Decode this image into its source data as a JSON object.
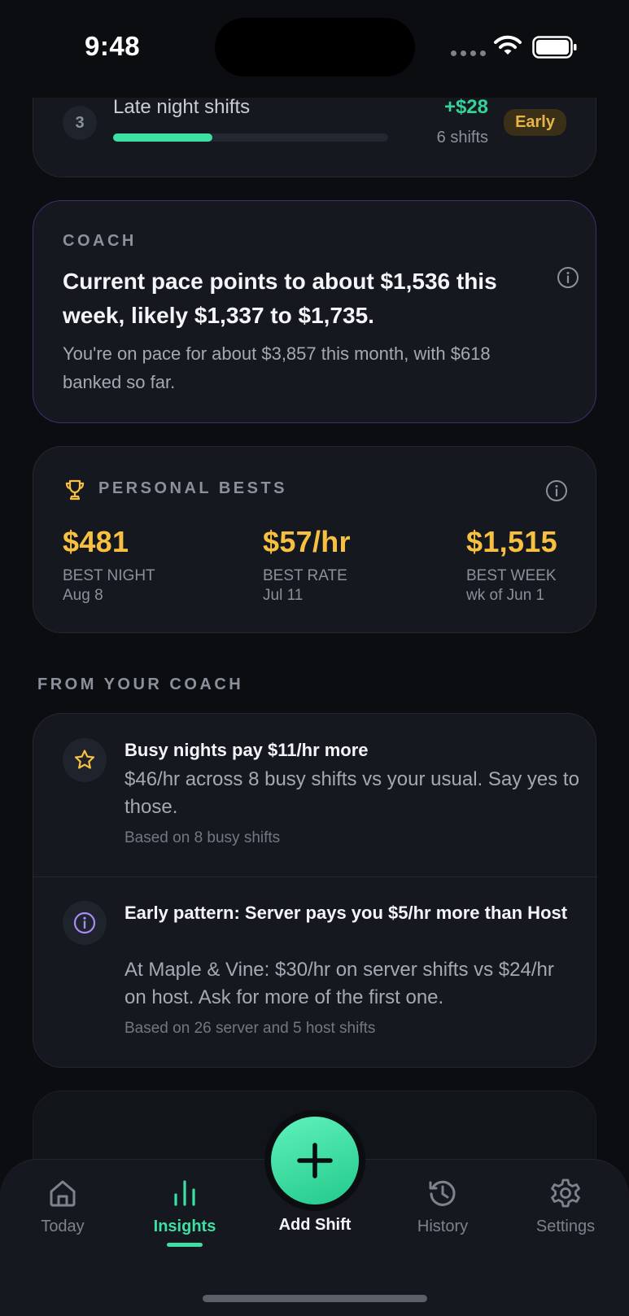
{
  "status_bar": {
    "time": "9:48"
  },
  "rank_item": {
    "rank": "3",
    "label": "Late night shifts",
    "progress_fraction": 0.36,
    "delta": "+$28",
    "count": "6 shifts",
    "badge": "Early"
  },
  "coach": {
    "eyebrow": "COACH",
    "headline": "Current pace points to about $1,536 this week, likely $1,337 to $1,735.",
    "sub": "You're on pace for about $3,857 this month, with $618 banked so far."
  },
  "personal_bests": {
    "eyebrow": "PERSONAL BESTS",
    "items": [
      {
        "value": "$481",
        "label": "BEST NIGHT",
        "date": "Aug 8"
      },
      {
        "value": "$57/hr",
        "label": "BEST RATE",
        "date": "Jul 11"
      },
      {
        "value": "$1,515",
        "label": "BEST WEEK",
        "date": "wk of Jun 1"
      }
    ]
  },
  "from_coach": {
    "title": "FROM YOUR COACH",
    "items": [
      {
        "icon": "star-icon",
        "title": "Busy nights pay $11/hr more",
        "body": "$46/hr across 8 busy shifts vs your usual. Say yes to those.",
        "meta": "Based on 8 busy shifts"
      },
      {
        "icon": "info-icon",
        "title": "Early pattern: Server pays you $5/hr more than Host",
        "body": "At Maple & Vine: $30/hr on server shifts vs $24/hr on host. Ask for more of the first one.",
        "meta": "Based on 26 server and 5 host shifts"
      }
    ]
  },
  "tabs": [
    {
      "label": "Today",
      "icon": "home-icon",
      "active": false
    },
    {
      "label": "Insights",
      "icon": "bar-chart-icon",
      "active": true
    },
    {
      "label": "Add Shift",
      "icon": "plus-icon",
      "active": false
    },
    {
      "label": "History",
      "icon": "history-icon",
      "active": false
    },
    {
      "label": "Settings",
      "icon": "gear-icon",
      "active": false
    }
  ],
  "colors": {
    "accent": "#3de0a3",
    "gold": "#f7c041",
    "badge_bg": "#3a2f17",
    "coach_border": "#3b3170",
    "background": "#0b0d11",
    "card": "#15181e"
  }
}
